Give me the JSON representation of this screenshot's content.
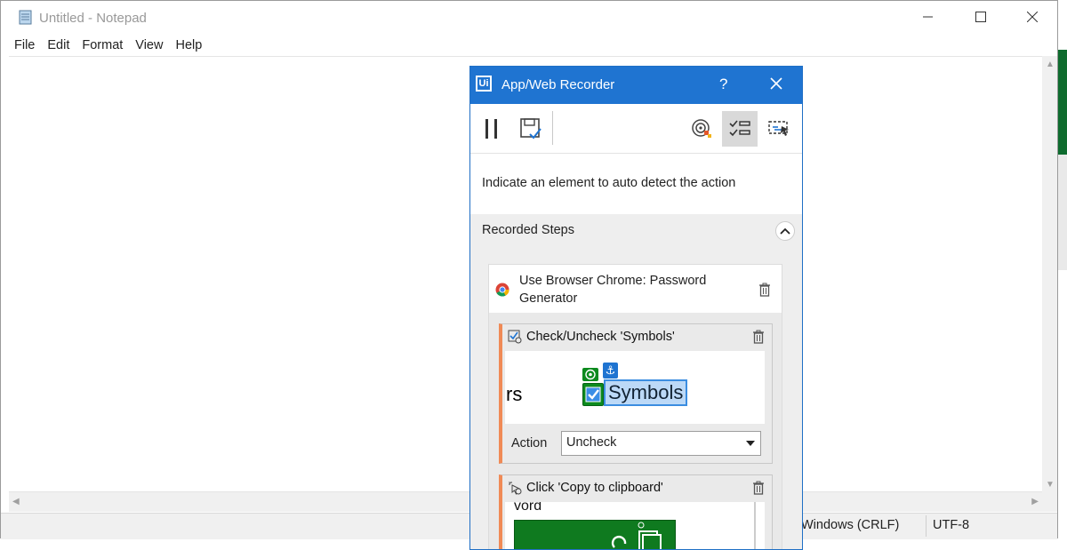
{
  "notepad": {
    "title": "Untitled - Notepad",
    "menu": [
      "File",
      "Edit",
      "Format",
      "View",
      "Help"
    ],
    "status": {
      "line_ending": "Windows (CRLF)",
      "encoding": "UTF-8"
    }
  },
  "recorder": {
    "title": "App/Web Recorder",
    "help": "?",
    "hint": "Indicate an element to auto detect the action",
    "steps_header": "Recorded Steps",
    "browser_step": {
      "title": "Use Browser Chrome: Password Generator"
    },
    "steps": [
      {
        "title": "Check/Uncheck 'Symbols'",
        "preview_left_text": "rs",
        "preview_element_text": "Symbols",
        "action_label": "Action",
        "action_value": "Uncheck"
      },
      {
        "title": "Click 'Copy to clipboard'",
        "preview_text": "vord"
      }
    ]
  },
  "colors": {
    "accent": "#1f74d1",
    "step_border": "#f08a56",
    "check_green": "#0c8a1e",
    "green_button": "#0f7a1f"
  },
  "icons": [
    "notepad-icon",
    "minimize-icon",
    "maximize-icon",
    "close-icon",
    "uipath-logo-icon",
    "pause-icon",
    "save-icon",
    "target-icon",
    "steps-list-icon",
    "screen-scan-icon",
    "chevron-up-icon",
    "chrome-icon",
    "trash-icon",
    "checkbox-action-icon",
    "click-action-icon",
    "anchor-icon"
  ]
}
